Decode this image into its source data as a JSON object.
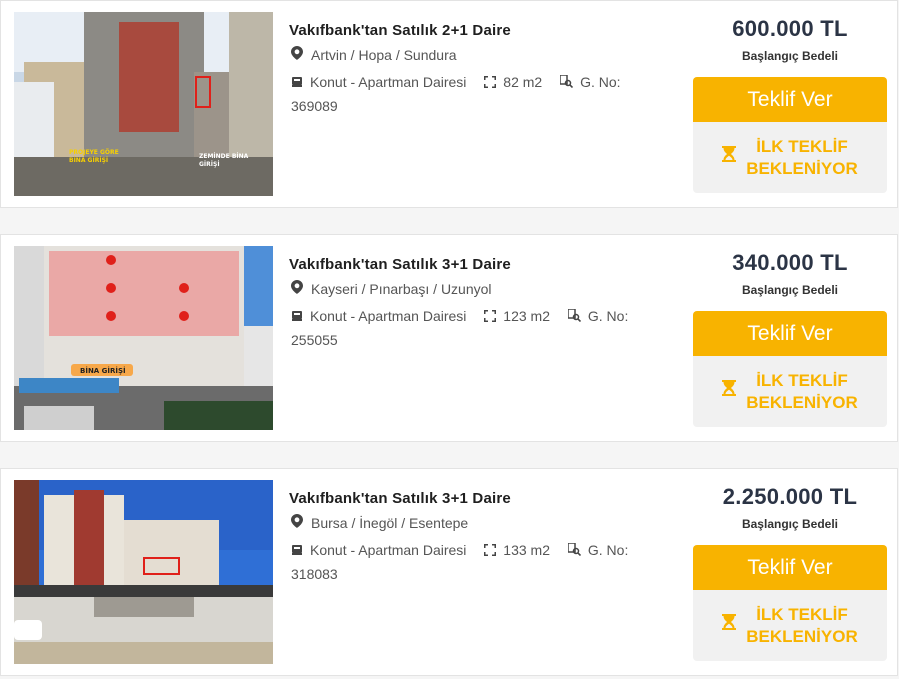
{
  "colors": {
    "accent": "#f8b300",
    "price_text": "#2b3445",
    "muted_bg": "#f1f1f1"
  },
  "icons": {
    "location": "map-pin-icon",
    "type": "building-icon",
    "area": "area-expand-icon",
    "no": "search-doc-icon",
    "wait": "hourglass-icon"
  },
  "listings": [
    {
      "title": "Vakıfbank'tan Satılık 2+1 Daire",
      "location": "Artvin / Hopa / Sundura",
      "type": "Konut - Apartman Dairesi",
      "area": "82 m2",
      "no_label": "G. No:",
      "no_value": "369089",
      "price": "600.000 TL",
      "price_label": "Başlangıç Bedeli",
      "bid_label": "Teklif Ver",
      "wait_line1": "İLK TEKLİF",
      "wait_line2": "BEKLENİYOR",
      "photo_labels": [
        "PROJEYE GÖRE BİNA GİRİŞİ",
        "ZEMİNDE BİNA GİRİŞİ"
      ]
    },
    {
      "title": "Vakıfbank'tan Satılık 3+1 Daire",
      "location": "Kayseri / Pınarbaşı / Uzunyol",
      "type": "Konut - Apartman Dairesi",
      "area": "123 m2",
      "no_label": "G. No:",
      "no_value": "255055",
      "price": "340.000 TL",
      "price_label": "Başlangıç Bedeli",
      "bid_label": "Teklif Ver",
      "wait_line1": "İLK TEKLİF",
      "wait_line2": "BEKLENİYOR",
      "photo_labels": [
        "BİNA GİRİŞİ"
      ]
    },
    {
      "title": "Vakıfbank'tan Satılık 3+1 Daire",
      "location": "Bursa / İnegöl / Esentepe",
      "type": "Konut - Apartman Dairesi",
      "area": "133 m2",
      "no_label": "G. No:",
      "no_value": "318083",
      "price": "2.250.000 TL",
      "price_label": "Başlangıç Bedeli",
      "bid_label": "Teklif Ver",
      "wait_line1": "İLK TEKLİF",
      "wait_line2": "BEKLENİYOR",
      "photo_labels": []
    }
  ]
}
